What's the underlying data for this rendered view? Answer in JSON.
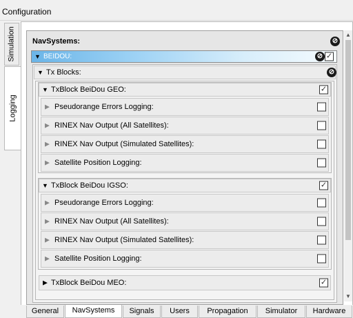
{
  "window": {
    "title": "Configuration"
  },
  "side_tabs": [
    {
      "label": "Simulation"
    },
    {
      "label": "Logging"
    }
  ],
  "navsystems": {
    "title": "NavSystems:",
    "beidou": {
      "label": "BEIDOU:",
      "tx_blocks": {
        "label": "Tx Blocks:",
        "blocks": [
          {
            "label": "TxBlock BeiDou GEO:",
            "checked": true,
            "items": [
              {
                "label": "Pseudorange Errors Logging:",
                "checked": false
              },
              {
                "label": "RINEX Nav Output (All Satellites):",
                "checked": false
              },
              {
                "label": "RINEX Nav Output (Simulated Satellites):",
                "checked": false
              },
              {
                "label": "Satellite Position Logging:",
                "checked": false
              }
            ]
          },
          {
            "label": "TxBlock BeiDou IGSO:",
            "checked": true,
            "items": [
              {
                "label": "Pseudorange Errors Logging:",
                "checked": false
              },
              {
                "label": "RINEX Nav Output (All Satellites):",
                "checked": false
              },
              {
                "label": "RINEX Nav Output (Simulated Satellites):",
                "checked": false
              },
              {
                "label": "Satellite Position Logging:",
                "checked": false
              }
            ]
          },
          {
            "label": "TxBlock BeiDou MEO:",
            "checked": true,
            "items": []
          }
        ]
      }
    }
  },
  "bottom_tabs": [
    {
      "label": "General"
    },
    {
      "label": "NavSystems"
    },
    {
      "label": "Signals"
    },
    {
      "label": "Users"
    },
    {
      "label": "Propagation"
    },
    {
      "label": "Simulator"
    },
    {
      "label": "Hardware"
    }
  ],
  "active_bottom_tab": "NavSystems",
  "colors": {
    "accent": "#6bb5e8",
    "panel_bg": "#e6e6e6"
  },
  "icons": {
    "collapse": "collapse-icon",
    "expand": "expand-icon",
    "clear": "clear-icon"
  }
}
